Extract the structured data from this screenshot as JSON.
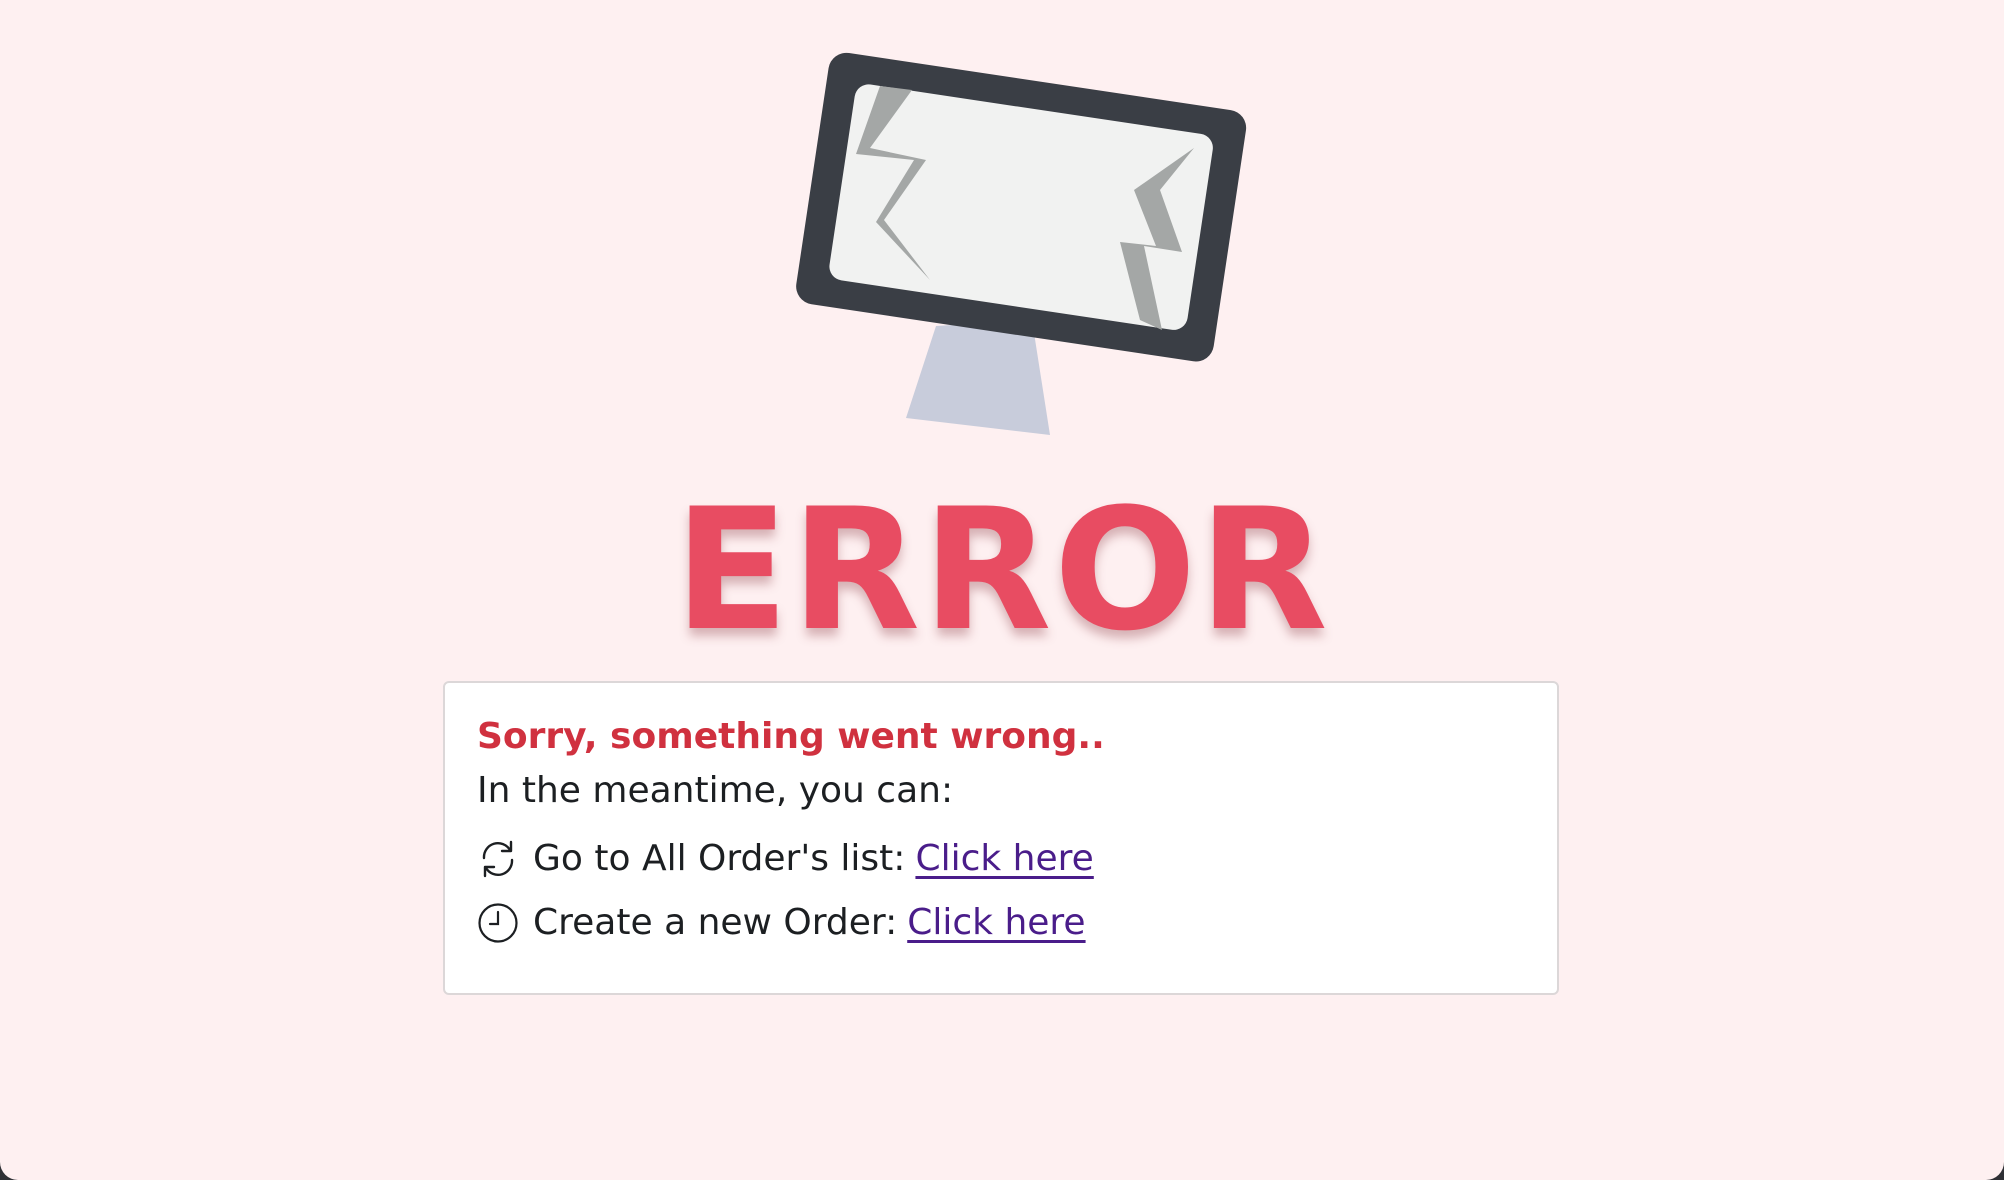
{
  "error": {
    "title": "ERROR"
  },
  "message": {
    "heading": "Sorry, something went wrong..",
    "subheading": "In the meantime, you can:"
  },
  "options": [
    {
      "icon": "refresh-icon",
      "label": "Go to All Order's list:",
      "link_text": "Click here"
    },
    {
      "icon": "clock-icon",
      "label": "Create a new Order:",
      "link_text": "Click here"
    }
  ],
  "colors": {
    "background": "#fef0f1",
    "error_title": "#e84c62",
    "heading": "#d0313f",
    "link": "#4a1d8a",
    "monitor_frame": "#3a3e45",
    "monitor_screen": "#f1f2f1",
    "monitor_stand": "#c8ccdb",
    "crack": "#a4a7a6"
  }
}
